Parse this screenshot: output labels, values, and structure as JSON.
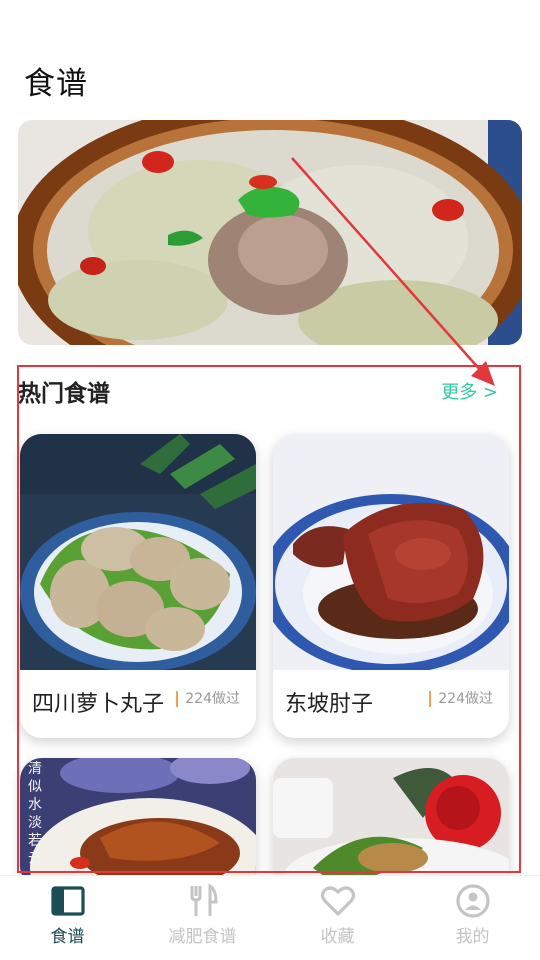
{
  "header": {
    "title": "食谱"
  },
  "hot_section": {
    "title": "热门食谱",
    "more_label": "更多 >"
  },
  "recipes": [
    {
      "name": "四川萝卜丸子",
      "count": "224做过"
    },
    {
      "name": "东坡肘子",
      "count": "224做过"
    },
    {
      "name": "",
      "count": ""
    },
    {
      "name": "",
      "count": ""
    }
  ],
  "card3_overlay": [
    "清",
    "似",
    "水",
    "淡",
    "若",
    "云"
  ],
  "tabbar": {
    "tabs": [
      {
        "label": "食谱",
        "icon": "recipe-book-icon",
        "active": true
      },
      {
        "label": "减肥食谱",
        "icon": "fork-knife-icon",
        "active": false
      },
      {
        "label": "收藏",
        "icon": "heart-icon",
        "active": false
      },
      {
        "label": "我的",
        "icon": "profile-icon",
        "active": false
      }
    ]
  },
  "colors": {
    "accent": "#2fcba0",
    "active_tab": "#1d4e57",
    "inactive_tab": "#c4c4c4",
    "annotation": "#e0383e",
    "count_bar": "#f0a05a"
  }
}
